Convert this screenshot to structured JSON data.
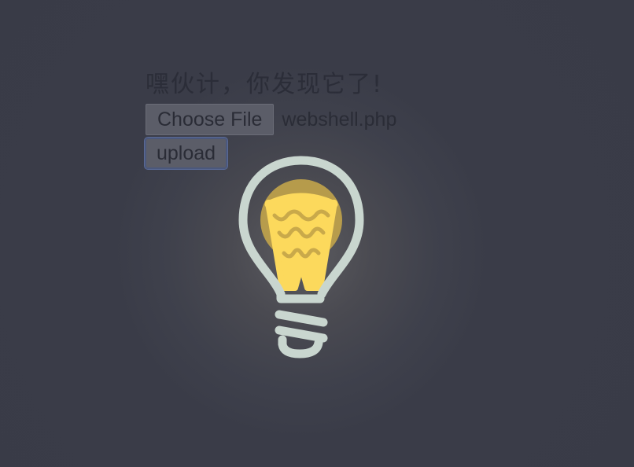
{
  "form": {
    "heading": "嘿伙计，你发现它了!",
    "choose_file_label": "Choose File",
    "selected_file": "webshell.php",
    "upload_label": "upload"
  },
  "colors": {
    "background": "#393b47",
    "bulb_outline": "#c9d6cf",
    "filament": "#fcd95c",
    "glow": "#c9a94a"
  },
  "icons": {
    "bulb": "lightbulb-icon"
  }
}
